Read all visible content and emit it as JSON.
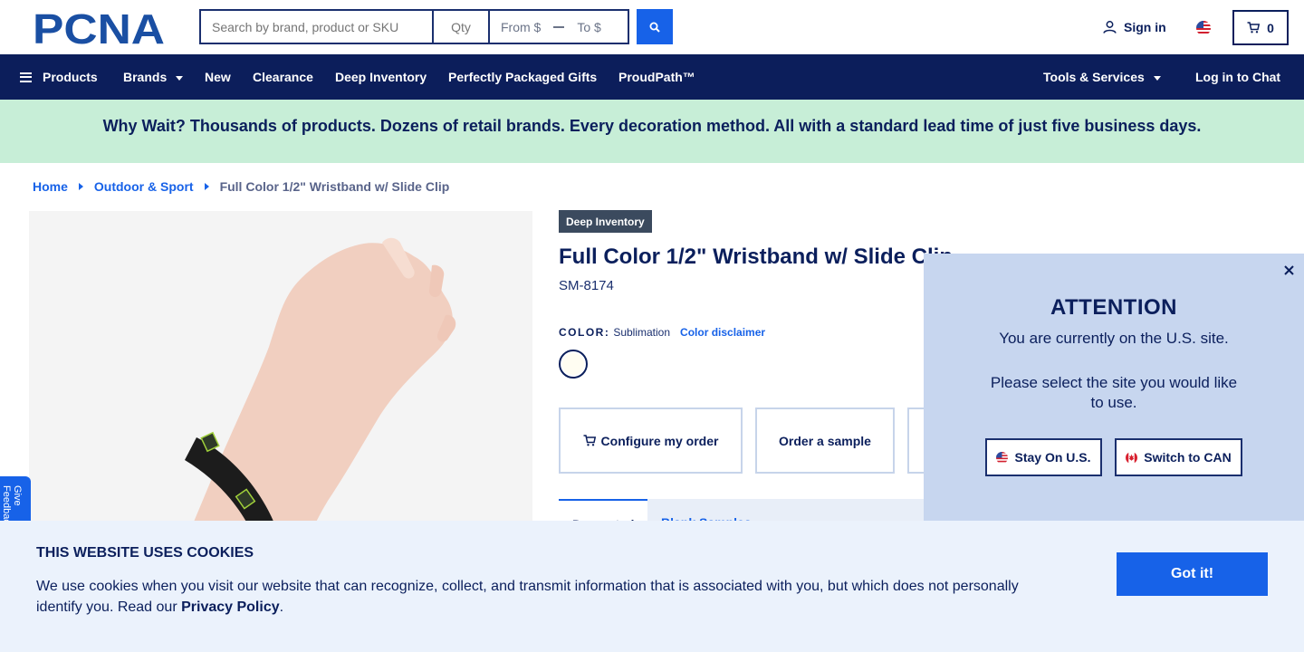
{
  "header": {
    "logo_text": "PCNA",
    "search": {
      "placeholder": "Search by brand, product or SKU"
    },
    "qty": {
      "placeholder": "Qty"
    },
    "price_from": "From $",
    "price_to": "To $",
    "sign_in": "Sign in",
    "cart_count": "0"
  },
  "nav": {
    "products": "Products",
    "brands": "Brands",
    "new": "New",
    "clearance": "Clearance",
    "deep_inventory": "Deep Inventory",
    "perfectly_packaged": "Perfectly Packaged Gifts",
    "proudpath": "ProudPath™",
    "tools": "Tools & Services",
    "chat": "Log in to Chat"
  },
  "promo": "Why Wait? Thousands of products. Dozens of retail brands. Every decoration method. All with a standard lead time of just five business days.",
  "breadcrumb": {
    "home": "Home",
    "category": "Outdoor & Sport",
    "current": "Full Color 1/2\" Wristband w/ Slide Clip"
  },
  "feedback": "Give Feedback",
  "product": {
    "badge": "Deep Inventory",
    "title": "Full Color 1/2\" Wristband w/ Slide Clip",
    "sku": "SM-8174",
    "color_label": "COLOR:",
    "color_value": "Sublimation",
    "color_disclaimer": "Color disclaimer",
    "actions": {
      "configure": "Configure my order",
      "sample": "Order a sample"
    },
    "tabs": {
      "active": "Decorated",
      "inactive": "Blank Samples"
    }
  },
  "country_popup": {
    "title": "ATTENTION",
    "line1": "You are currently on the U.S. site.",
    "line2": "Please select the site you would like to use.",
    "stay": "Stay On U.S.",
    "switch": "Switch to CAN"
  },
  "cookie": {
    "title": "THIS WEBSITE USES COOKIES",
    "text": "We use cookies when you visit our website that can recognize, collect, and transmit information that is associated with you, but which does not personally identify you. Read our ",
    "link": "Privacy Policy",
    "end": ".",
    "button": "Got it!"
  },
  "colors": {
    "navy": "#0c1e5b",
    "blue": "#1762e8",
    "promo_bg": "#c7eed7",
    "popup_bg": "#c7d6ef",
    "cookie_bg": "#ebf2fc"
  },
  "icons": [
    "search-icon",
    "user-icon",
    "us-flag-icon",
    "cart-icon",
    "menu-icon",
    "close-icon",
    "canada-flag-icon"
  ]
}
